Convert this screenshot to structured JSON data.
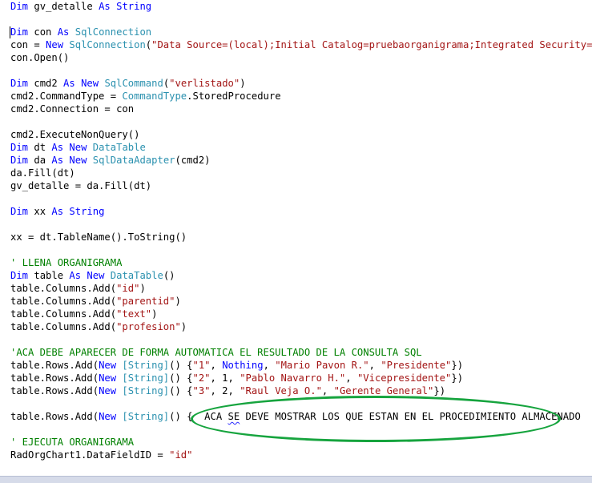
{
  "editor": {
    "lines": [
      {
        "tokens": [
          {
            "t": "Dim",
            "c": "kw"
          },
          {
            "t": " gv_detalle ",
            "c": "plain"
          },
          {
            "t": "As",
            "c": "kw"
          },
          {
            "t": " ",
            "c": "plain"
          },
          {
            "t": "String",
            "c": "kw"
          }
        ]
      },
      {
        "tokens": []
      },
      {
        "tokens": [
          {
            "t": "Dim",
            "c": "kw"
          },
          {
            "t": " con ",
            "c": "plain"
          },
          {
            "t": "As",
            "c": "kw"
          },
          {
            "t": " ",
            "c": "plain"
          },
          {
            "t": "SqlConnection",
            "c": "type"
          }
        ]
      },
      {
        "tokens": [
          {
            "t": "con = ",
            "c": "plain"
          },
          {
            "t": "New",
            "c": "kw"
          },
          {
            "t": " ",
            "c": "plain"
          },
          {
            "t": "SqlConnection",
            "c": "type"
          },
          {
            "t": "(",
            "c": "plain"
          },
          {
            "t": "\"Data Source=(local);Initial Catalog=pruebaorganigrama;Integrated Security=True\"",
            "c": "str"
          },
          {
            "t": ")",
            "c": "plain"
          }
        ]
      },
      {
        "tokens": [
          {
            "t": "con.Open()",
            "c": "plain"
          }
        ]
      },
      {
        "tokens": []
      },
      {
        "tokens": [
          {
            "t": "Dim",
            "c": "kw"
          },
          {
            "t": " cmd2 ",
            "c": "plain"
          },
          {
            "t": "As",
            "c": "kw"
          },
          {
            "t": " ",
            "c": "plain"
          },
          {
            "t": "New",
            "c": "kw"
          },
          {
            "t": " ",
            "c": "plain"
          },
          {
            "t": "SqlCommand",
            "c": "type"
          },
          {
            "t": "(",
            "c": "plain"
          },
          {
            "t": "\"verlistado\"",
            "c": "str"
          },
          {
            "t": ")",
            "c": "plain"
          }
        ]
      },
      {
        "tokens": [
          {
            "t": "cmd2.CommandType = ",
            "c": "plain"
          },
          {
            "t": "CommandType",
            "c": "type"
          },
          {
            "t": ".StoredProcedure",
            "c": "plain"
          }
        ]
      },
      {
        "tokens": [
          {
            "t": "cmd2.Connection = con",
            "c": "plain"
          }
        ]
      },
      {
        "tokens": []
      },
      {
        "tokens": [
          {
            "t": "cmd2.ExecuteNonQuery()",
            "c": "plain"
          }
        ]
      },
      {
        "tokens": [
          {
            "t": "Dim",
            "c": "kw"
          },
          {
            "t": " dt ",
            "c": "plain"
          },
          {
            "t": "As",
            "c": "kw"
          },
          {
            "t": " ",
            "c": "plain"
          },
          {
            "t": "New",
            "c": "kw"
          },
          {
            "t": " ",
            "c": "plain"
          },
          {
            "t": "DataTable",
            "c": "type"
          }
        ]
      },
      {
        "tokens": [
          {
            "t": "Dim",
            "c": "kw"
          },
          {
            "t": " da ",
            "c": "plain"
          },
          {
            "t": "As",
            "c": "kw"
          },
          {
            "t": " ",
            "c": "plain"
          },
          {
            "t": "New",
            "c": "kw"
          },
          {
            "t": " ",
            "c": "plain"
          },
          {
            "t": "SqlDataAdapter",
            "c": "type"
          },
          {
            "t": "(cmd2)",
            "c": "plain"
          }
        ]
      },
      {
        "tokens": [
          {
            "t": "da.Fill(dt)",
            "c": "plain"
          }
        ]
      },
      {
        "tokens": [
          {
            "t": "gv_detalle = da.Fill(dt)",
            "c": "plain"
          }
        ]
      },
      {
        "tokens": []
      },
      {
        "tokens": [
          {
            "t": "Dim",
            "c": "kw"
          },
          {
            "t": " xx ",
            "c": "plain"
          },
          {
            "t": "As",
            "c": "kw"
          },
          {
            "t": " ",
            "c": "plain"
          },
          {
            "t": "String",
            "c": "kw"
          }
        ]
      },
      {
        "tokens": []
      },
      {
        "tokens": [
          {
            "t": "xx = dt.TableName().ToString()",
            "c": "plain"
          }
        ]
      },
      {
        "tokens": []
      },
      {
        "tokens": [
          {
            "t": "' LLENA ORGANIGRAMA",
            "c": "com"
          }
        ]
      },
      {
        "tokens": [
          {
            "t": "Dim",
            "c": "kw"
          },
          {
            "t": " table ",
            "c": "plain"
          },
          {
            "t": "As",
            "c": "kw"
          },
          {
            "t": " ",
            "c": "plain"
          },
          {
            "t": "New",
            "c": "kw"
          },
          {
            "t": " ",
            "c": "plain"
          },
          {
            "t": "DataTable",
            "c": "type"
          },
          {
            "t": "()",
            "c": "plain"
          }
        ]
      },
      {
        "tokens": [
          {
            "t": "table.Columns.Add(",
            "c": "plain"
          },
          {
            "t": "\"id\"",
            "c": "str"
          },
          {
            "t": ")",
            "c": "plain"
          }
        ]
      },
      {
        "tokens": [
          {
            "t": "table.Columns.Add(",
            "c": "plain"
          },
          {
            "t": "\"parentid\"",
            "c": "str"
          },
          {
            "t": ")",
            "c": "plain"
          }
        ]
      },
      {
        "tokens": [
          {
            "t": "table.Columns.Add(",
            "c": "plain"
          },
          {
            "t": "\"text\"",
            "c": "str"
          },
          {
            "t": ")",
            "c": "plain"
          }
        ]
      },
      {
        "tokens": [
          {
            "t": "table.Columns.Add(",
            "c": "plain"
          },
          {
            "t": "\"profesion\"",
            "c": "str"
          },
          {
            "t": ")",
            "c": "plain"
          }
        ]
      },
      {
        "tokens": []
      },
      {
        "tokens": [
          {
            "t": "'ACA DEBE APARECER DE FORMA AUTOMATICA EL RESULTADO DE LA CONSULTA SQL",
            "c": "com"
          }
        ]
      },
      {
        "tokens": [
          {
            "t": "table.Rows.Add(",
            "c": "plain"
          },
          {
            "t": "New",
            "c": "kw"
          },
          {
            "t": " ",
            "c": "plain"
          },
          {
            "t": "[String]",
            "c": "type"
          },
          {
            "t": "() {",
            "c": "plain"
          },
          {
            "t": "\"1\"",
            "c": "str"
          },
          {
            "t": ", ",
            "c": "plain"
          },
          {
            "t": "Nothing",
            "c": "kw"
          },
          {
            "t": ", ",
            "c": "plain"
          },
          {
            "t": "\"Mario Pavon R.\"",
            "c": "str"
          },
          {
            "t": ", ",
            "c": "plain"
          },
          {
            "t": "\"Presidente\"",
            "c": "str"
          },
          {
            "t": "})",
            "c": "plain"
          }
        ]
      },
      {
        "tokens": [
          {
            "t": "table.Rows.Add(",
            "c": "plain"
          },
          {
            "t": "New",
            "c": "kw"
          },
          {
            "t": " ",
            "c": "plain"
          },
          {
            "t": "[String]",
            "c": "type"
          },
          {
            "t": "() {",
            "c": "plain"
          },
          {
            "t": "\"2\"",
            "c": "str"
          },
          {
            "t": ", 1, ",
            "c": "plain"
          },
          {
            "t": "\"Pablo Navarro H.\"",
            "c": "str"
          },
          {
            "t": ", ",
            "c": "plain"
          },
          {
            "t": "\"Vicepresidente\"",
            "c": "str"
          },
          {
            "t": "})",
            "c": "plain"
          }
        ]
      },
      {
        "tokens": [
          {
            "t": "table.Rows.Add(",
            "c": "plain"
          },
          {
            "t": "New",
            "c": "kw"
          },
          {
            "t": " ",
            "c": "plain"
          },
          {
            "t": "[String]",
            "c": "type"
          },
          {
            "t": "() {",
            "c": "plain"
          },
          {
            "t": "\"3\"",
            "c": "str"
          },
          {
            "t": ", 2, ",
            "c": "plain"
          },
          {
            "t": "\"Raul Veja O.\"",
            "c": "str"
          },
          {
            "t": ", ",
            "c": "plain"
          },
          {
            "t": "\"Gerente General\"",
            "c": "str"
          },
          {
            "t": "})",
            "c": "plain"
          }
        ]
      },
      {
        "tokens": []
      },
      {
        "tokens": [
          {
            "t": "table.Rows.Add(",
            "c": "plain"
          },
          {
            "t": "New",
            "c": "kw"
          },
          {
            "t": " ",
            "c": "plain"
          },
          {
            "t": "[String]",
            "c": "type"
          },
          {
            "t": "() {  ",
            "c": "plain"
          },
          {
            "t": "ACA",
            "c": "plain"
          },
          {
            "t": " ",
            "c": "plain"
          },
          {
            "t": "SE",
            "c": "squig"
          },
          {
            "t": " DEVE MOSTRAR LOS QUE ESTAN EN EL PROCEDIMIENTO ALMACENADO   })",
            "c": "plain"
          }
        ]
      },
      {
        "tokens": []
      },
      {
        "tokens": [
          {
            "t": "' EJECUTA ORGANIGRAMA",
            "c": "com"
          }
        ]
      },
      {
        "tokens": [
          {
            "t": "RadOrgChart1.DataFieldID = ",
            "c": "plain"
          },
          {
            "t": "\"id\"",
            "c": "str"
          }
        ]
      }
    ]
  },
  "colors": {
    "keyword": "#0000ff",
    "type": "#2b91af",
    "string": "#a31515",
    "comment": "#008000",
    "highlight": "#16a43e"
  },
  "annotation": {
    "shape": "ellipse",
    "color": "#16a43e"
  }
}
